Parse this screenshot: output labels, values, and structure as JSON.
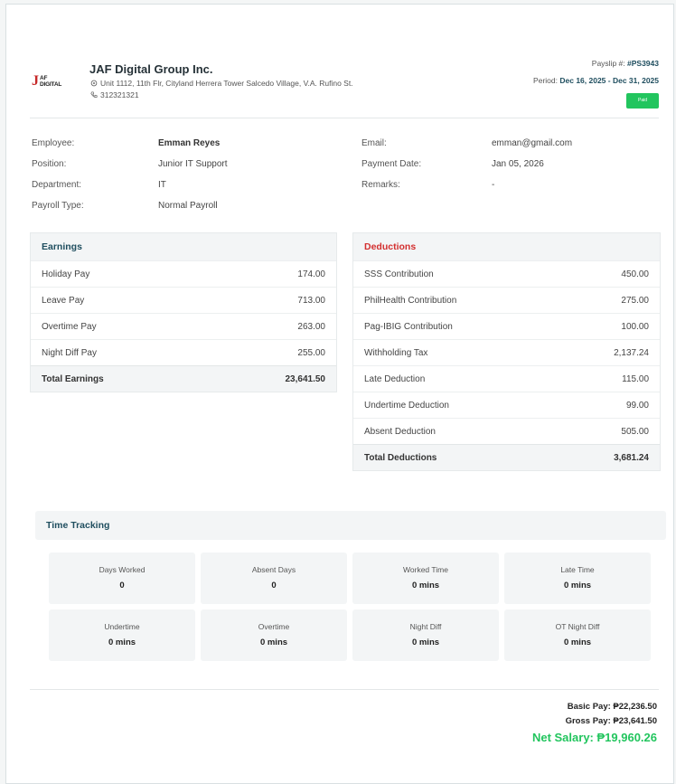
{
  "company": {
    "logo_text": "AF DIGITAL",
    "name": "JAF Digital Group Inc.",
    "address": "Unit 1112, 11th Flr, Cityland Herrera Tower Salcedo Village, V.A. Rufino St.",
    "phone": "312321321"
  },
  "payslip": {
    "number_label": "Payslip #:",
    "number": "#PS3943",
    "period_label": "Period:",
    "period": "Dec 16, 2025 - Dec 31, 2025",
    "status": "Paid"
  },
  "employee_info": {
    "left": [
      {
        "label": "Employee:",
        "value": "Emman Reyes"
      },
      {
        "label": "Position:",
        "value": "Junior IT Support"
      },
      {
        "label": "Department:",
        "value": "IT"
      },
      {
        "label": "Payroll Type:",
        "value": "Normal Payroll"
      }
    ],
    "right": [
      {
        "label": "Email:",
        "value": "emman@gmail.com"
      },
      {
        "label": "Payment Date:",
        "value": "Jan 05, 2026"
      },
      {
        "label": "Remarks:",
        "value": "-"
      }
    ]
  },
  "earnings": {
    "title": "Earnings",
    "rows": [
      {
        "label": "Holiday Pay",
        "amount": "174.00"
      },
      {
        "label": "Leave Pay",
        "amount": "713.00"
      },
      {
        "label": "Overtime Pay",
        "amount": "263.00"
      },
      {
        "label": "Night Diff Pay",
        "amount": "255.00"
      }
    ],
    "total_label": "Total Earnings",
    "total": "23,641.50"
  },
  "deductions": {
    "title": "Deductions",
    "rows": [
      {
        "label": "SSS Contribution",
        "amount": "450.00"
      },
      {
        "label": "PhilHealth Contribution",
        "amount": "275.00"
      },
      {
        "label": "Pag-IBIG Contribution",
        "amount": "100.00"
      },
      {
        "label": "Withholding Tax",
        "amount": "2,137.24"
      },
      {
        "label": "Late Deduction",
        "amount": "115.00"
      },
      {
        "label": "Undertime Deduction",
        "amount": "99.00"
      },
      {
        "label": "Absent Deduction",
        "amount": "505.00"
      }
    ],
    "total_label": "Total Deductions",
    "total": "3,681.24"
  },
  "time_tracking": {
    "title": "Time Tracking",
    "cells": [
      {
        "label": "Days Worked",
        "value": "0"
      },
      {
        "label": "Absent Days",
        "value": "0"
      },
      {
        "label": "Worked Time",
        "value": "0 mins"
      },
      {
        "label": "Late Time",
        "value": "0 mins"
      },
      {
        "label": "Undertime",
        "value": "0 mins"
      },
      {
        "label": "Overtime",
        "value": "0 mins"
      },
      {
        "label": "Night Diff",
        "value": "0 mins"
      },
      {
        "label": "OT Night Diff",
        "value": "0 mins"
      }
    ]
  },
  "totals": {
    "basic_pay": "Basic Pay: ₱22,236.50",
    "gross_pay": "Gross Pay: ₱23,641.50",
    "net_salary": "Net Salary: ₱19,960.26"
  },
  "colors": {
    "accent": "#1f4e5f",
    "deduction_red": "#d32f2f",
    "paid_green": "#22c55e",
    "net_green": "#22c55e"
  }
}
